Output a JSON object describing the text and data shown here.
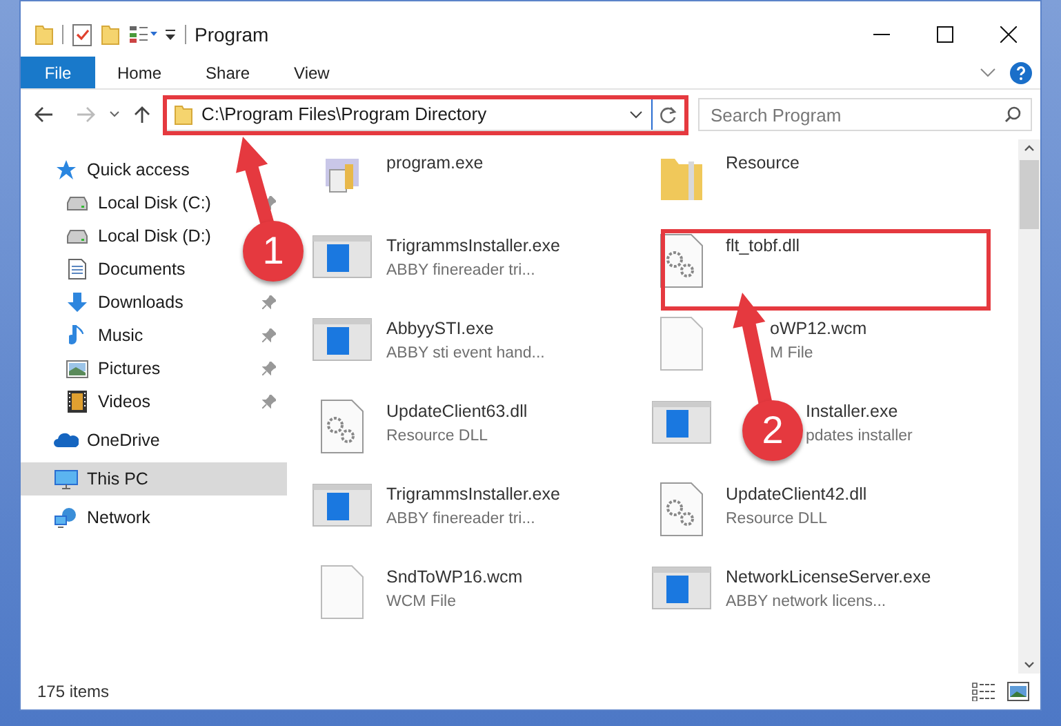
{
  "window": {
    "title": "Program"
  },
  "ribbon_tabs": [
    {
      "label": "File",
      "kind": "file"
    },
    {
      "label": "Home",
      "kind": "tab"
    },
    {
      "label": "Share",
      "kind": "tab"
    },
    {
      "label": "View",
      "kind": "tab"
    }
  ],
  "address_bar": {
    "path": "C:\\Program Files\\Program Directory"
  },
  "search": {
    "placeholder": "Search Program"
  },
  "navigation": [
    {
      "label": "Quick access",
      "kind": "quick",
      "pinned": false,
      "selected": false
    },
    {
      "label": "Local Disk (C:)",
      "kind": "drive",
      "pinned": true,
      "selected": false
    },
    {
      "label": "Local Disk (D:)",
      "kind": "drive",
      "pinned": false,
      "selected": false
    },
    {
      "label": "Documents",
      "kind": "documents",
      "pinned": false,
      "selected": false
    },
    {
      "label": "Downloads",
      "kind": "downloads",
      "pinned": true,
      "selected": false
    },
    {
      "label": "Music",
      "kind": "music",
      "pinned": true,
      "selected": false
    },
    {
      "label": "Pictures",
      "kind": "pictures",
      "pinned": true,
      "selected": false
    },
    {
      "label": "Videos",
      "kind": "videos",
      "pinned": true,
      "selected": false
    },
    {
      "label": "OneDrive",
      "kind": "cloud",
      "pinned": false,
      "selected": false
    },
    {
      "label": "This PC",
      "kind": "pc",
      "pinned": false,
      "selected": true
    },
    {
      "label": "Network",
      "kind": "network",
      "pinned": false,
      "selected": false
    }
  ],
  "files": [
    {
      "name": "program.exe",
      "kind": "app"
    },
    {
      "name": "Resource",
      "kind": "folder"
    },
    {
      "name": "TrigrammsInstaller.exe",
      "description": "ABBY finereader tri...",
      "kind": "installer"
    },
    {
      "name": "flt_tobf.dll",
      "kind": "dll"
    },
    {
      "name": "AbbyySTI.exe",
      "description": "ABBY sti event hand...",
      "kind": "installer"
    },
    {
      "name": "oWP12.wcm",
      "description": "M File",
      "kind": "document",
      "partly_hidden": true
    },
    {
      "name": "UpdateClient63.dll",
      "description": "Resource DLL",
      "kind": "dll"
    },
    {
      "name": "Installer.exe",
      "description": "pdates installer",
      "kind": "installer",
      "partly_hidden": true
    },
    {
      "name": "TrigrammsInstaller.exe",
      "description": "ABBY finereader tri...",
      "kind": "installer"
    },
    {
      "name": "UpdateClient42.dll",
      "description": "Resource DLL",
      "kind": "dll"
    },
    {
      "name": "SndToWP16.wcm",
      "description": "WCM File",
      "kind": "document"
    },
    {
      "name": "NetworkLicenseServer.exe",
      "description": "ABBY network licens...",
      "kind": "installer"
    }
  ],
  "status_bar": {
    "item_count": "175 items"
  },
  "annotations": [
    {
      "number": "1"
    },
    {
      "number": "2"
    }
  ]
}
